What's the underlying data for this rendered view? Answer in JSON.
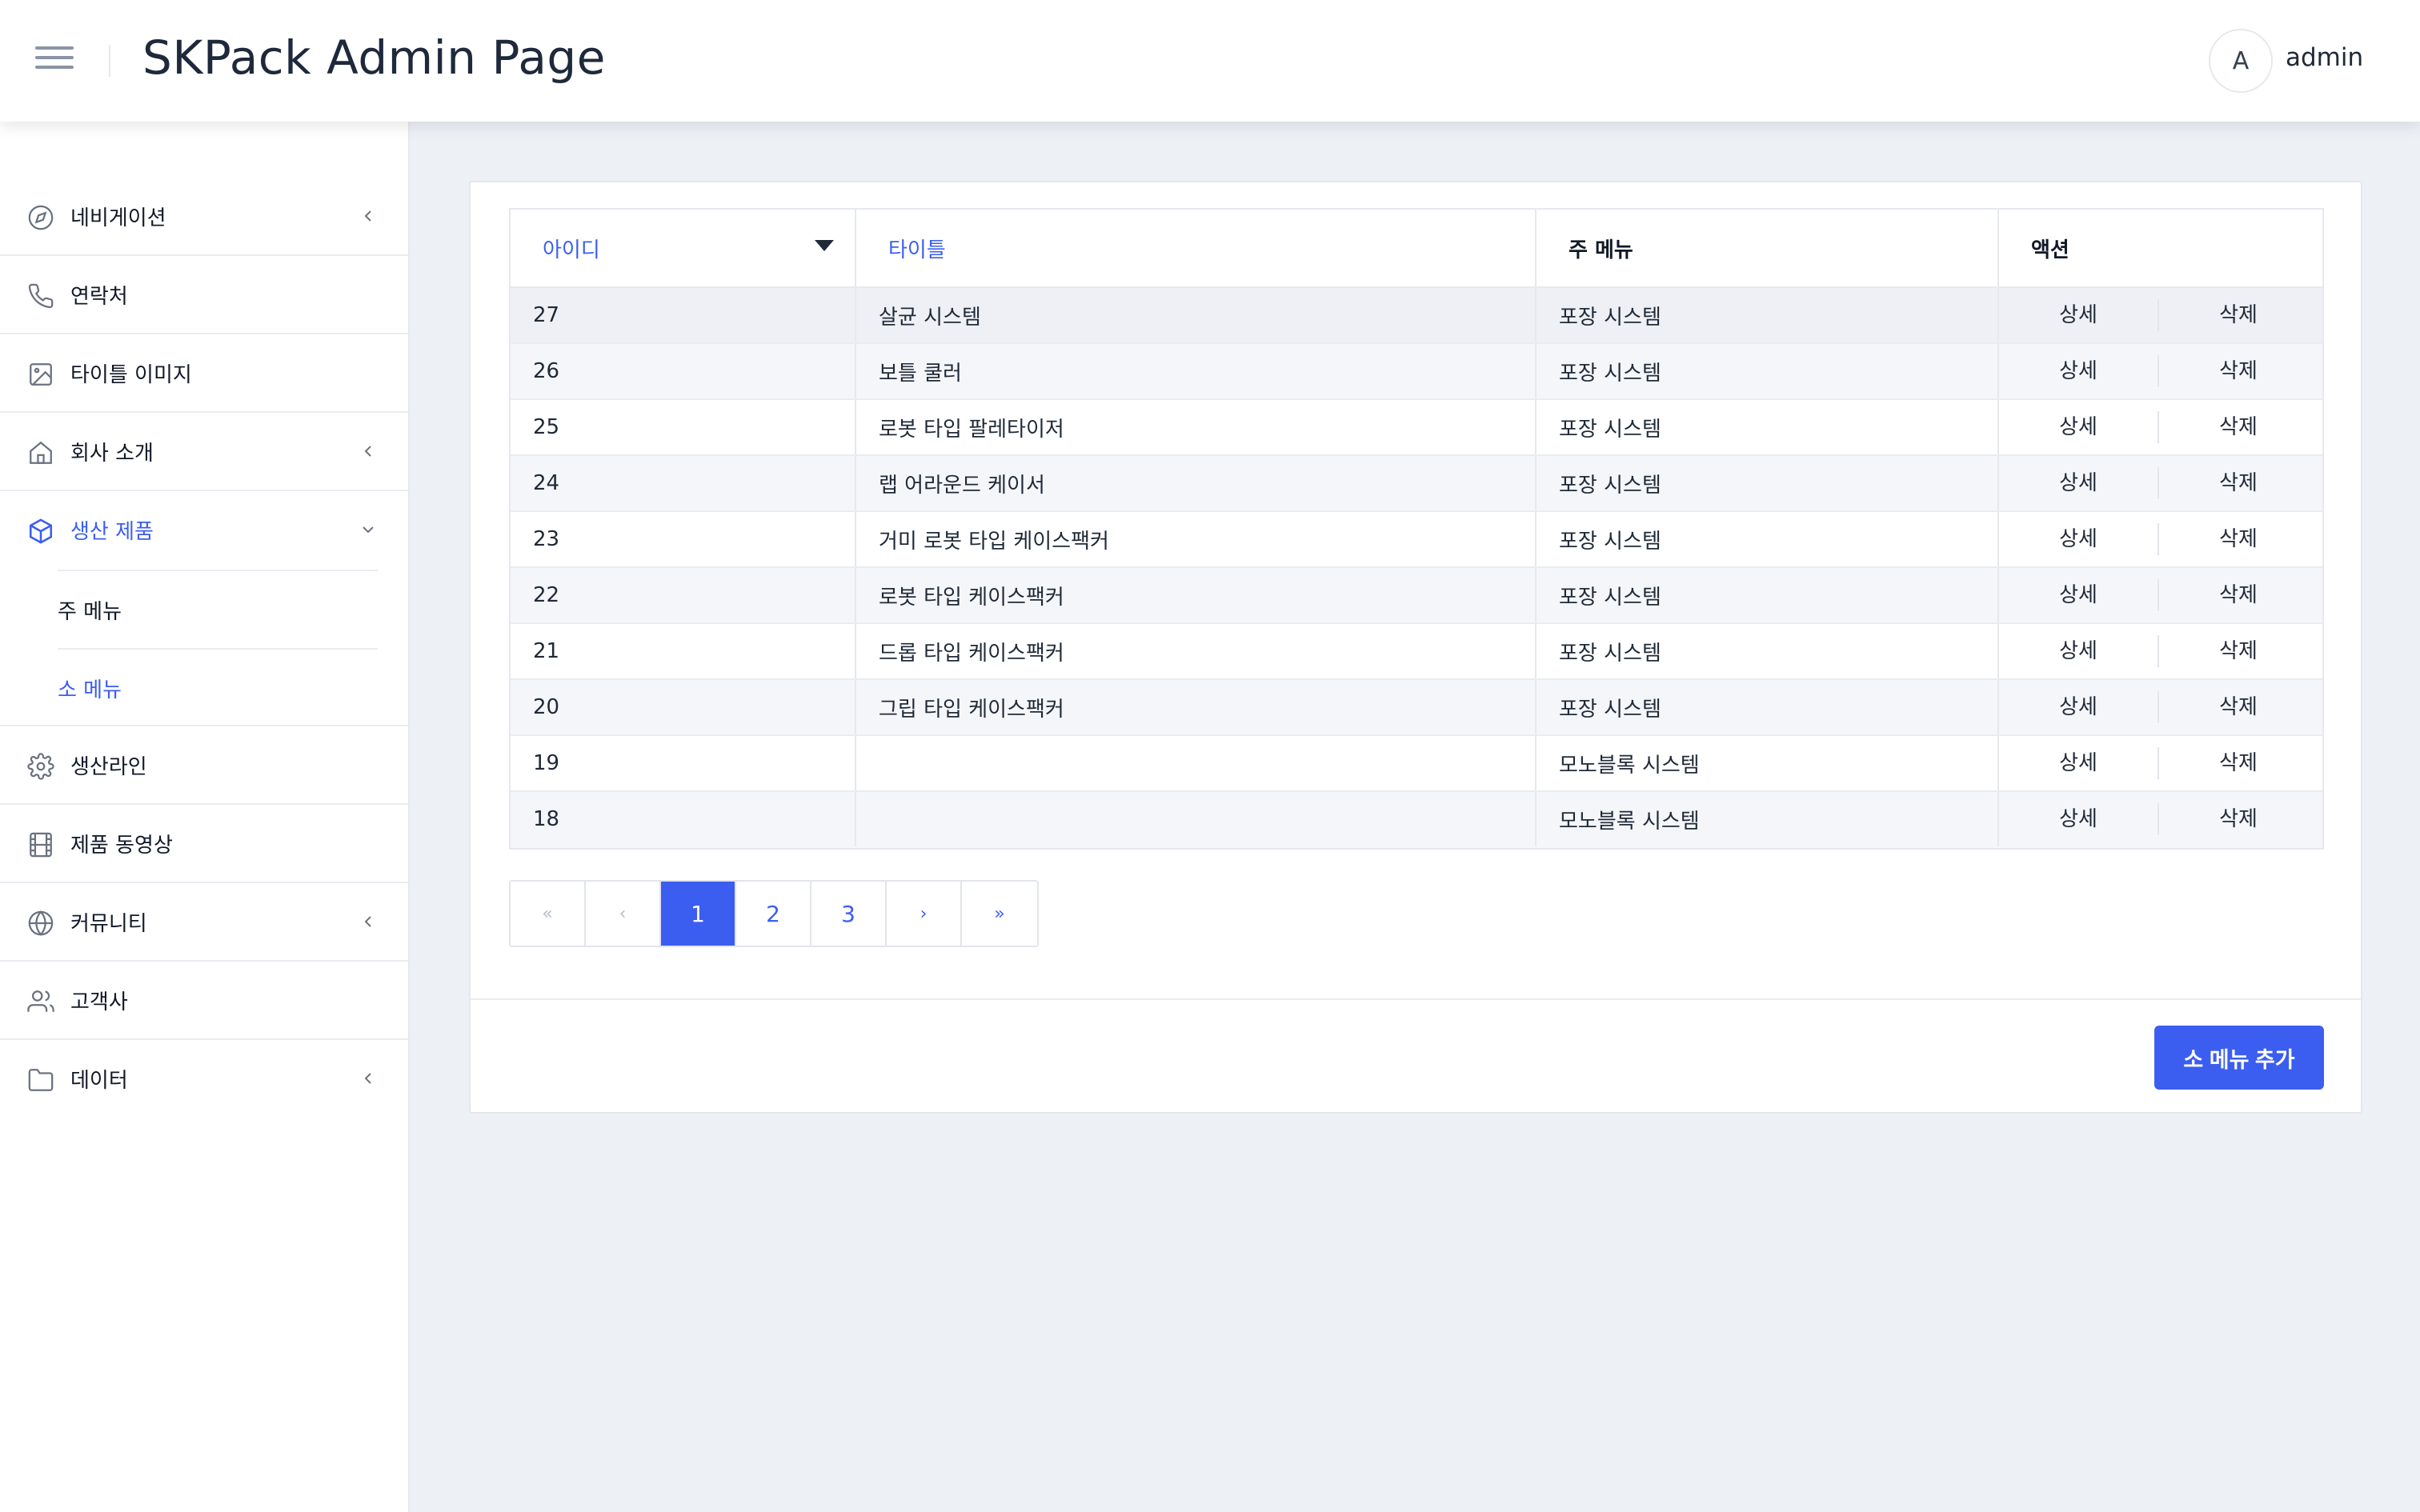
{
  "header": {
    "title": "SKPack Admin Page",
    "user_initial": "A",
    "user_name": "admin"
  },
  "sidebar": {
    "items": [
      {
        "label": "네비게이션",
        "icon": "compass-icon",
        "chevron": "left"
      },
      {
        "label": "연락처",
        "icon": "phone-icon"
      },
      {
        "label": "타이틀 이미지",
        "icon": "image-icon"
      },
      {
        "label": "회사 소개",
        "icon": "home-icon",
        "chevron": "left"
      },
      {
        "label": "생산 제품",
        "icon": "box-icon",
        "chevron": "down",
        "active": true,
        "children": [
          {
            "label": "주 메뉴"
          },
          {
            "label": "소 메뉴",
            "active": true
          }
        ]
      },
      {
        "label": "생산라인",
        "icon": "gear-icon"
      },
      {
        "label": "제품 동영상",
        "icon": "film-icon"
      },
      {
        "label": "커뮤니티",
        "icon": "globe-icon",
        "chevron": "left"
      },
      {
        "label": "고객사",
        "icon": "users-icon"
      },
      {
        "label": "데이터",
        "icon": "folder-icon",
        "chevron": "left"
      }
    ]
  },
  "table": {
    "columns": [
      "아이디",
      "타이틀",
      "주 메뉴",
      "액션"
    ],
    "rows": [
      {
        "id": "27",
        "title": "살균 시스템",
        "main_menu": "포장 시스템"
      },
      {
        "id": "26",
        "title": "보틀 쿨러",
        "main_menu": "포장 시스템"
      },
      {
        "id": "25",
        "title": "로봇 타입 팔레타이저",
        "main_menu": "포장 시스템"
      },
      {
        "id": "24",
        "title": "랩 어라운드 케이서",
        "main_menu": "포장 시스템"
      },
      {
        "id": "23",
        "title": "거미 로봇 타입 케이스팩커",
        "main_menu": "포장 시스템"
      },
      {
        "id": "22",
        "title": "로봇 타입 케이스팩커",
        "main_menu": "포장 시스템"
      },
      {
        "id": "21",
        "title": "드롭 타입 케이스팩커",
        "main_menu": "포장 시스템"
      },
      {
        "id": "20",
        "title": "그립 타입 케이스팩커",
        "main_menu": "포장 시스템"
      },
      {
        "id": "19",
        "title": "",
        "main_menu": "모노블록 시스템"
      },
      {
        "id": "18",
        "title": "",
        "main_menu": "모노블록 시스템"
      }
    ],
    "action_detail": "상세",
    "action_delete": "삭제"
  },
  "pagination": {
    "first": "«",
    "prev": "‹",
    "pages": [
      "1",
      "2",
      "3"
    ],
    "current": "1",
    "next": "›",
    "last": "»"
  },
  "add_button": "소 메뉴 추가",
  "colors": {
    "accent": "#3b5ef0",
    "background": "#edf0f5",
    "text": "#1f2937"
  }
}
